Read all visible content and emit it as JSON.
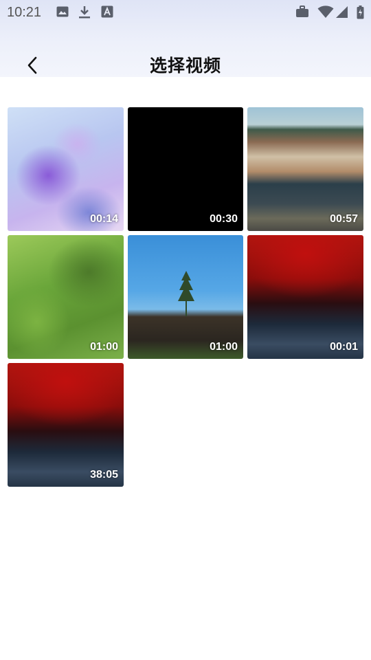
{
  "status_bar": {
    "time": "10:21",
    "left_icons": [
      "image-icon",
      "download-icon",
      "a-badge-icon"
    ],
    "right_icons": [
      "briefcase-icon",
      "wifi-icon",
      "signal-icon",
      "battery-icon"
    ]
  },
  "header": {
    "title": "选择视频",
    "back_icon": "chevron-left-icon"
  },
  "videos": [
    {
      "duration": "00:14"
    },
    {
      "duration": "00:30"
    },
    {
      "duration": "00:57"
    },
    {
      "duration": "01:00"
    },
    {
      "duration": "01:00"
    },
    {
      "duration": "00:01"
    },
    {
      "duration": "38:05"
    }
  ]
}
